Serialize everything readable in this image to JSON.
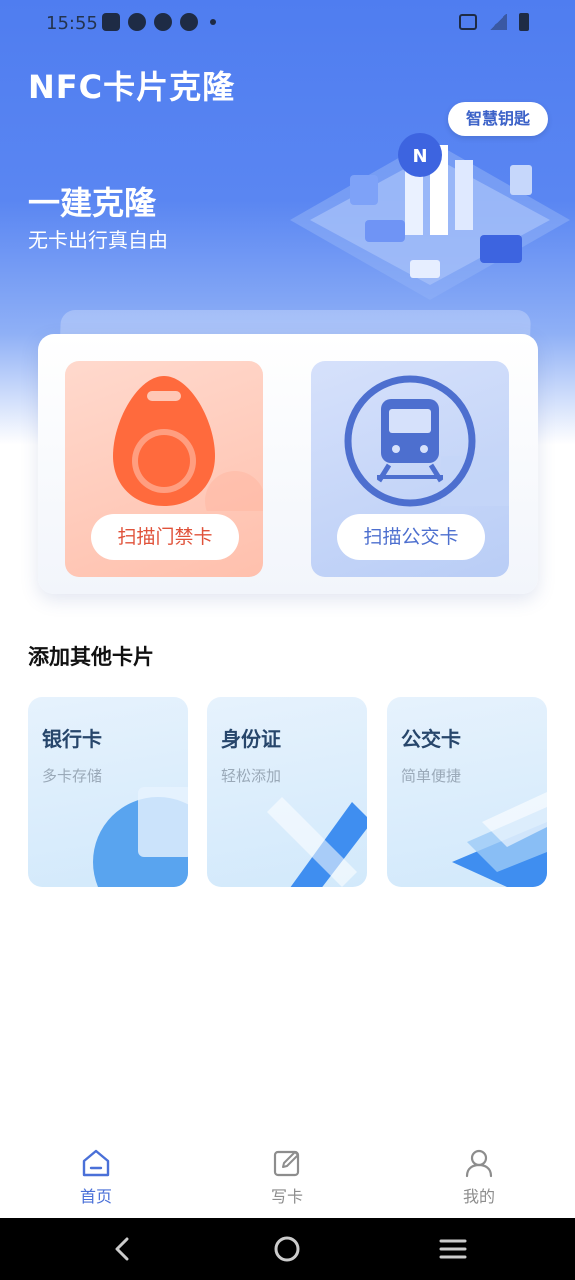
{
  "status_bar": {
    "time": "15:55"
  },
  "header": {
    "title": "NFC卡片克隆",
    "slogan": "一建克隆",
    "subslogan": "无卡出行真自由",
    "key_badge": "智慧钥匙"
  },
  "scan": {
    "access_card_button": "扫描门禁卡",
    "bus_card_button": "扫描公交卡"
  },
  "add_section": {
    "title": "添加其他卡片",
    "cards": [
      {
        "title": "银行卡",
        "subtitle": "多卡存储"
      },
      {
        "title": "身份证",
        "subtitle": "轻松添加"
      },
      {
        "title": "公交卡",
        "subtitle": "简单便捷"
      }
    ]
  },
  "tab_bar": {
    "tabs": [
      {
        "label": "首页",
        "icon": "home-icon",
        "active": true
      },
      {
        "label": "写卡",
        "icon": "edit-icon",
        "active": false
      },
      {
        "label": "我的",
        "icon": "profile-icon",
        "active": false
      }
    ]
  },
  "colors": {
    "accent": "#4a70d8",
    "hero_blue": "#4f7df0",
    "access_orange": "#ff6a3d",
    "bus_blue": "#4d6fcf"
  }
}
